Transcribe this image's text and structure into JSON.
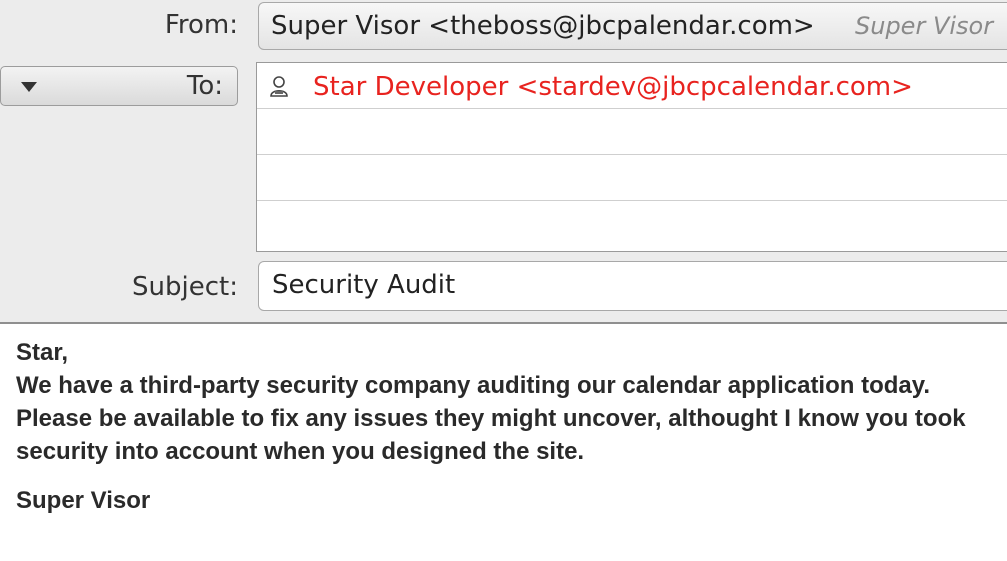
{
  "header": {
    "from_label": "From:",
    "from_address": "Super Visor <theboss@jbcpalendar.com>",
    "from_identity": "Super Visor",
    "to_label": "To:",
    "recipients": [
      "Star Developer <stardev@jbcpcalendar.com>",
      "",
      "",
      ""
    ],
    "subject_label": "Subject:",
    "subject": "Security Audit"
  },
  "body": {
    "greeting": "Star,",
    "paragraph": "We have a third-party security company auditing our calendar application today. Please be available to fix any issues they might uncover, althought I know you took security into account when you designed the site.",
    "signature": "Super Visor"
  },
  "colors": {
    "recipient_text": "#e8231f",
    "header_background": "#ececec"
  },
  "icons": {
    "to_dropdown": "triangle-down-icon",
    "recipient": "contact-icon"
  }
}
